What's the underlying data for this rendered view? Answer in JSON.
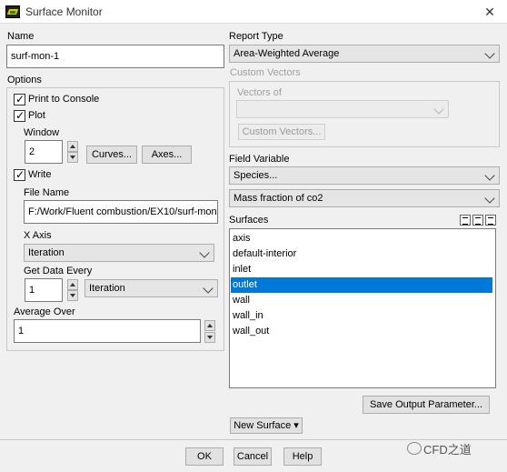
{
  "window": {
    "title": "Surface Monitor",
    "close_glyph": "✕"
  },
  "name": {
    "label": "Name",
    "value": "surf-mon-1"
  },
  "options": {
    "label": "Options",
    "print_to_console": "Print to Console",
    "plot": "Plot",
    "window_label": "Window",
    "window_value": "2",
    "curves_button": "Curves...",
    "axes_button": "Axes...",
    "write": "Write",
    "file_name_label": "File Name",
    "file_name_value": "F:/Work/Fluent combustion/EX10/surf-mon",
    "x_axis_label": "X Axis",
    "x_axis_value": "Iteration",
    "get_data_every_label": "Get Data Every",
    "get_data_every_value": "1",
    "get_data_every_unit": "Iteration",
    "average_over_label": "Average Over",
    "average_over_value": "1"
  },
  "report_type": {
    "label": "Report Type",
    "value": "Area-Weighted Average"
  },
  "custom_vectors": {
    "label": "Custom Vectors",
    "vectors_of_label": "Vectors of",
    "vectors_of_value": "",
    "button": "Custom Vectors..."
  },
  "field_variable": {
    "label": "Field Variable",
    "category": "Species...",
    "value": "Mass fraction of co2"
  },
  "surfaces": {
    "label": "Surfaces",
    "items": [
      "axis",
      "default-interior",
      "inlet",
      "outlet",
      "wall",
      "wall_in",
      "wall_out"
    ],
    "selected": "outlet"
  },
  "save_output_parameter": "Save Output Parameter...",
  "new_surface": "New Surface ▾",
  "footer": {
    "ok": "OK",
    "cancel": "Cancel",
    "help": "Help"
  },
  "watermark": "CFD之道",
  "colors": {
    "selection": "#0078d7",
    "dialog_bg": "#f0f0f0"
  }
}
